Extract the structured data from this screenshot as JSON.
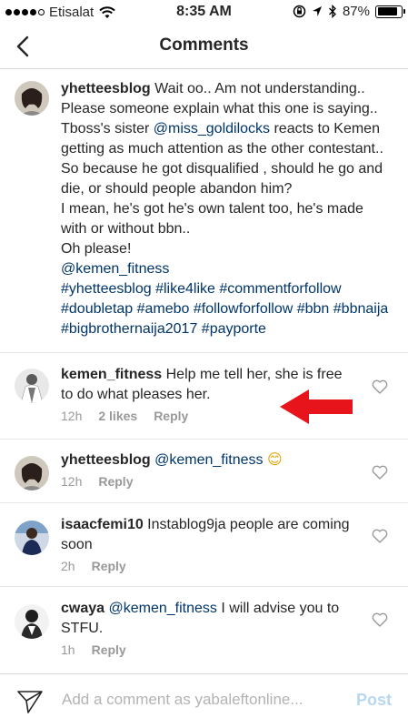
{
  "status": {
    "carrier": "Etisalat",
    "time": "8:35 AM",
    "battery": "87%",
    "battery_level": 0.87,
    "signal_bars": 4,
    "icons": [
      "wifi-icon",
      "orientation-lock-icon",
      "location-icon",
      "bluetooth-icon",
      "battery-icon"
    ]
  },
  "nav": {
    "title": "Comments",
    "back_icon": "chevron-left-icon"
  },
  "caption": {
    "username": "yhetteesblog",
    "text_1": " Wait oo.. Am not understanding.. Please someone explain what this one is saying.. Tboss's sister ",
    "mention_1": "@miss_goldilocks",
    "text_2": " reacts to Kemen getting as much attention as the other contestant.. So because he got disqualified , should he go and die, or should people abandon him?",
    "line_2": "I mean, he's got he's own talent too, he's made with or without bbn..",
    "line_3": "Oh please!",
    "mention_2": "@kemen_fitness",
    "hashtags": "#yhetteesblog #like4like #commentforfollow #doubletap #amebo #followforfollow #bbn #bbnaija #bigbrothernaija2017 #payporte"
  },
  "comments": [
    {
      "username": "kemen_fitness",
      "text": " Help me tell her, she is free to do what pleases her.",
      "time": "12h",
      "likes": "2 likes",
      "reply": "Reply"
    },
    {
      "username": "yhetteesblog",
      "mention": "@kemen_fitness",
      "emoji": "😊",
      "time": "12h",
      "reply": "Reply"
    },
    {
      "username": "isaacfemi10",
      "text": " Instablog9ja people are coming soon",
      "time": "2h",
      "reply": "Reply"
    },
    {
      "username": "cwaya",
      "mention": "@kemen_fitness",
      "text": " I will advise you to STFU.",
      "time": "1h",
      "reply": "Reply"
    }
  ],
  "composer": {
    "placeholder": "Add a comment as yabaleftonline...",
    "post_label": "Post",
    "send_icon": "direct-send-icon"
  },
  "colors": {
    "link": "#003569",
    "meta": "#999999",
    "post_disabled": "#b8d7f3",
    "arrow": "#e8141b"
  }
}
